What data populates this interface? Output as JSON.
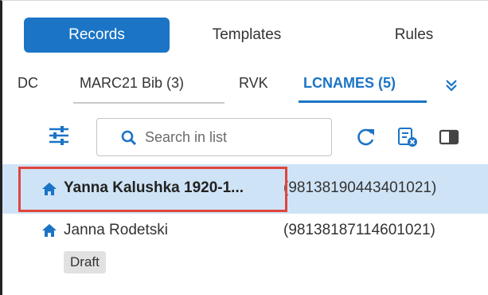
{
  "top_tabs": [
    {
      "label": "Records",
      "active": true
    },
    {
      "label": "Templates",
      "active": false
    },
    {
      "label": "Rules",
      "active": false
    }
  ],
  "sub_tabs": [
    {
      "label": "DC"
    },
    {
      "label": "MARC21 Bib (3)"
    },
    {
      "label": "RVK"
    },
    {
      "label": "LCNAMES (5)",
      "active": true
    }
  ],
  "more_tabs_icon": "chevron-double-down-icon",
  "toolbar": {
    "filter_icon": "sliders-icon",
    "search_placeholder": "Search in list",
    "refresh_icon": "refresh-icon",
    "clear_icon": "clear-list-icon",
    "panel_icon": "split-panel-icon"
  },
  "records": [
    {
      "name": "Yanna Kalushka 1920-1...",
      "id": "(98138190443401021)",
      "icon": "home-icon",
      "selected": true,
      "badge": ""
    },
    {
      "name": "Janna Rodetski",
      "id": "(98138187114601021)",
      "icon": "home-icon",
      "selected": false,
      "badge": "Draft"
    }
  ],
  "colors": {
    "accent": "#1b74c5",
    "selected_row": "#cfe3f6",
    "highlight": "#e0453c"
  }
}
